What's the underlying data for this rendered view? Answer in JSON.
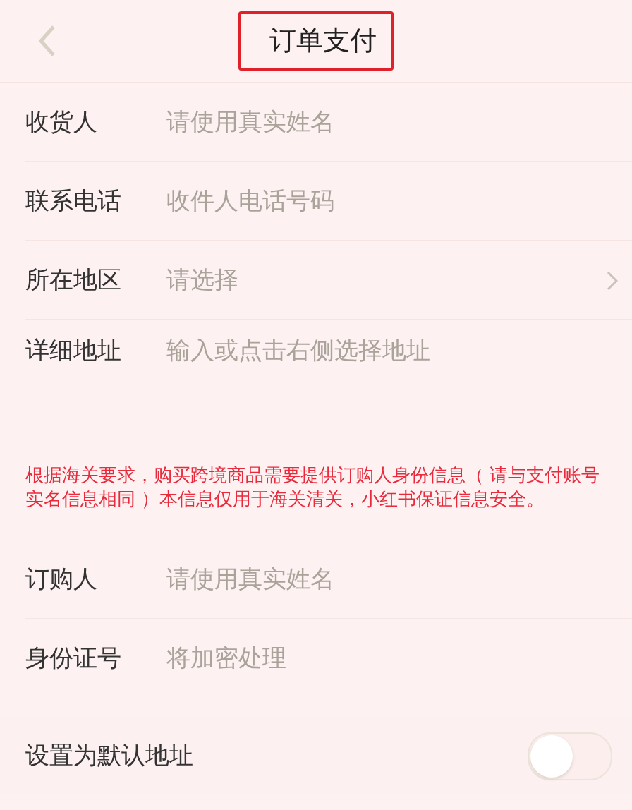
{
  "header": {
    "title": "订单支付",
    "title_highlighted": true
  },
  "address_fields": [
    {
      "label": "收货人",
      "placeholder": "请使用真实姓名",
      "kind": "text"
    },
    {
      "label": "联系电话",
      "placeholder": "收件人电话号码",
      "kind": "text"
    },
    {
      "label": "所在地区",
      "placeholder": "请选择",
      "kind": "select"
    },
    {
      "label": "详细地址",
      "placeholder": "输入或点击右侧选择地址",
      "kind": "textarea"
    }
  ],
  "customs_notice": "根据海关要求，购买跨境商品需要提供订购人身份信息（ 请与支付账号实名信息相同 ）本信息仅用于海关清关，小红书保证信息安全。",
  "buyer_fields": [
    {
      "label": "订购人",
      "placeholder": "请使用真实姓名"
    },
    {
      "label": "身份证号",
      "placeholder": "将加密处理"
    }
  ],
  "default_address": {
    "label": "设置为默认地址",
    "on": false
  }
}
